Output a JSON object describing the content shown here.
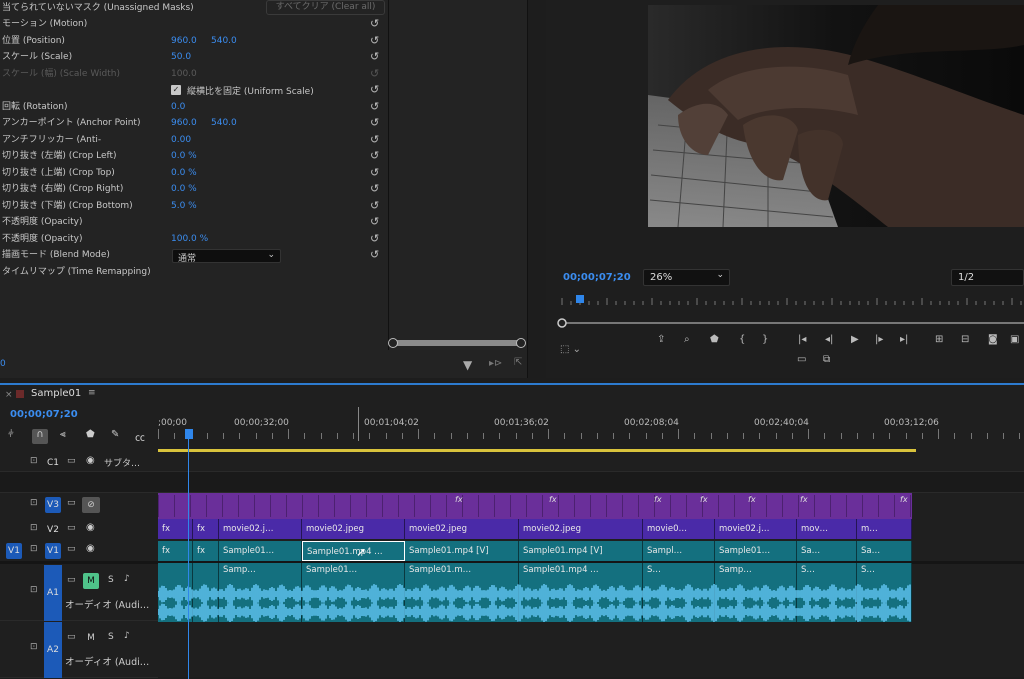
{
  "effect_controls": {
    "unassigned_masks": "当てられていないマスク (Unassigned Masks)",
    "clear_all": "すべてクリア (Clear all)",
    "rows": [
      {
        "label": "モーション (Motion)",
        "v1": "",
        "v2": ""
      },
      {
        "label": "位置 (Position)",
        "v1": "960.0",
        "v2": "540.0"
      },
      {
        "label": "スケール (Scale)",
        "v1": "50.0",
        "v2": ""
      },
      {
        "label": "スケール (幅) (Scale Width)",
        "v1": "100.0",
        "v2": "",
        "dim": true
      },
      {
        "label": "",
        "v1": "",
        "v2": ""
      },
      {
        "label": "回転 (Rotation)",
        "v1": "0.0",
        "v2": ""
      },
      {
        "label": "アンカーポイント (Anchor Point)",
        "v1": "960.0",
        "v2": "540.0"
      },
      {
        "label": "アンチフリッカー (Anti-",
        "v1": "0.00",
        "v2": ""
      },
      {
        "label": "切り抜き (左端) (Crop Left)",
        "v1": "0.0 %",
        "v2": ""
      },
      {
        "label": "切り抜き (上端) (Crop Top)",
        "v1": "0.0 %",
        "v2": ""
      },
      {
        "label": "切り抜き (右端) (Crop Right)",
        "v1": "0.0 %",
        "v2": ""
      },
      {
        "label": "切り抜き (下端) (Crop Bottom)",
        "v1": "5.0 %",
        "v2": ""
      },
      {
        "label": "不透明度 (Opacity)",
        "v1": "",
        "v2": ""
      },
      {
        "label": "不透明度 (Opacity)",
        "v1": "100.0 %",
        "v2": ""
      },
      {
        "label": "描画モード (Blend Mode)",
        "v1": "",
        "v2": ""
      },
      {
        "label": "タイムリマップ (Time Remapping)",
        "v1": "",
        "v2": ""
      }
    ],
    "uniform_scale": "縦横比を固定 (Uniform Scale)",
    "blend_mode_value": "通常",
    "footer_time": "0"
  },
  "program": {
    "timecode": "00;00;07;20",
    "zoom": "26%",
    "resolution": "1/2",
    "playhead_fraction": 0.03
  },
  "timeline": {
    "sequence_name": "Sample01",
    "timecode": "00;00;07;20",
    "ruler": [
      ";00;00",
      "00;00;32;00",
      "00;01;04;02",
      "00;01;36;02",
      "00;02;08;04",
      "00;02;40;04",
      "00;03;12;06"
    ],
    "tracks": {
      "c1": "C1",
      "c1_name": "サブタ…",
      "v3": "V3",
      "v2": "V2",
      "v1": "V1",
      "v1_src": "V1",
      "a1": "A1",
      "a1_name": "オーディオ (Audi…",
      "a2": "A2",
      "a2_name": "オーディオ (Audi…",
      "m": "M",
      "s": "S"
    },
    "v2_clips": [
      "fx",
      "fx",
      "movie02.j…",
      "movie02.jpeg",
      "movie02.jpeg",
      "movie02.jpeg",
      "movie0…",
      "movie02.j…",
      "mov…",
      "m…"
    ],
    "v1_clips": [
      "fx",
      "fx",
      "Sample01…",
      "Sample01.mp4 …",
      "Sample01.mp4 [V]",
      "Sample01.mp4 [V]",
      "Sampl…",
      "Sample01…",
      "Sa…",
      "Sa…"
    ],
    "a1_clips": [
      "",
      "",
      "Samp…",
      "Sample01…",
      "Sample01.m…",
      "Sample01.mp4 …",
      "S…",
      "Samp…",
      "S…",
      "S…"
    ],
    "fx_label": "fx"
  }
}
